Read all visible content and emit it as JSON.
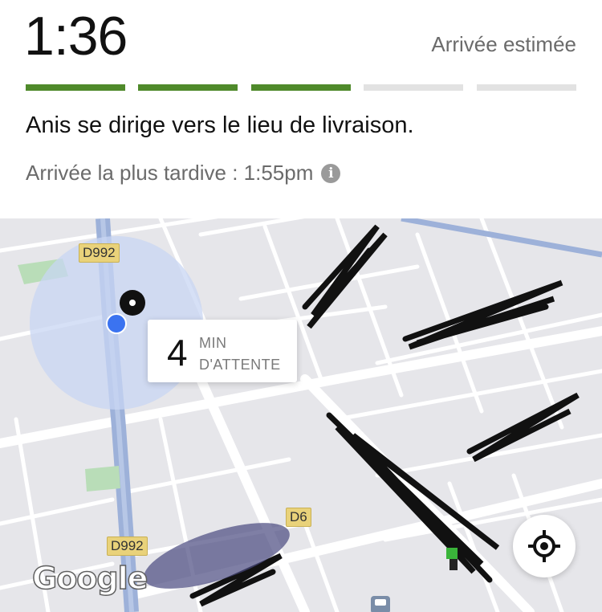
{
  "header": {
    "eta_time": "1:36",
    "eta_label": "Arrivée estimée",
    "progress": {
      "completed_steps": 3,
      "total_steps": 5,
      "active_color": "#4f8a2b",
      "inactive_color": "#e2e2e2"
    },
    "status_text": "Anis se dirige vers le lieu de livraison.",
    "latest_arrival": "Arrivée la plus tardive : 1:55pm"
  },
  "map": {
    "road_labels": {
      "d992_top": "D992",
      "d992_bottom": "D992",
      "d6": "D6"
    },
    "wait_card": {
      "number": "4",
      "unit_line1": "MIN",
      "unit_line2": "D'ATTENTE"
    },
    "google_attribution": "Google",
    "colors": {
      "user_dot": "#3b73f0",
      "accuracy_circle": "#c8d6f3",
      "main_road": "#9db1d9"
    }
  }
}
